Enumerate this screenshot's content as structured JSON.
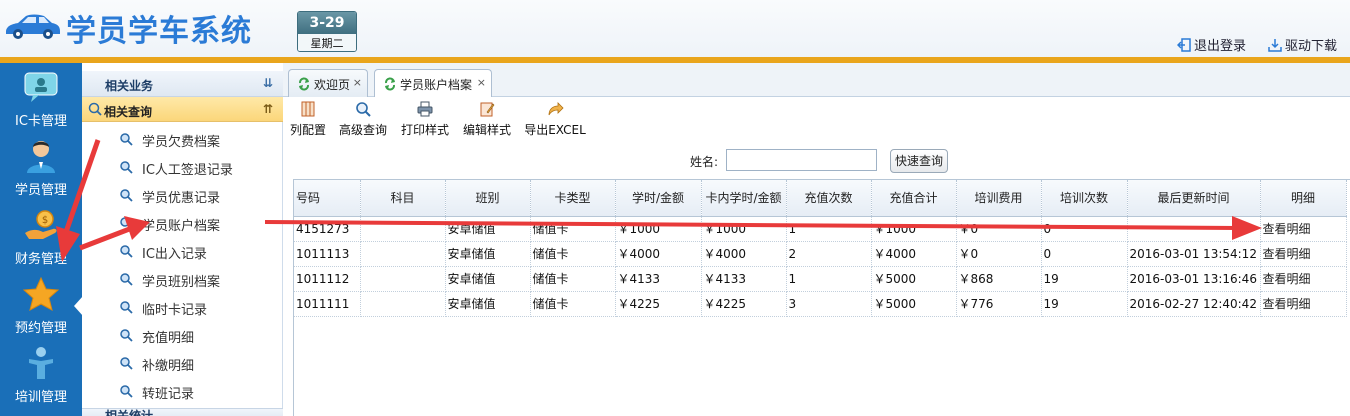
{
  "header": {
    "app_title": "学员学车系统",
    "date": "3-29",
    "weekday": "星期二",
    "logout_label": "退出登录",
    "driver_download_label": "驱动下载",
    "title_color": "#2b7bd6",
    "accent_color": "#e9a51c"
  },
  "iconbar": {
    "items": [
      {
        "label": "IC卡管理",
        "icon": "ic-card-icon"
      },
      {
        "label": "学员管理",
        "icon": "student-icon"
      },
      {
        "label": "财务管理",
        "icon": "finance-icon"
      },
      {
        "label": "预约管理",
        "icon": "star-icon"
      },
      {
        "label": "培训管理",
        "icon": "training-icon"
      }
    ]
  },
  "menu": {
    "header": "相关业务",
    "section": "相关查询",
    "items": [
      {
        "label": "学员欠费档案"
      },
      {
        "label": "IC人工签退记录"
      },
      {
        "label": "学员优惠记录"
      },
      {
        "label": "学员账户档案"
      },
      {
        "label": "IC出入记录"
      },
      {
        "label": "学员班别档案"
      },
      {
        "label": "临时卡记录"
      },
      {
        "label": "充值明细"
      },
      {
        "label": "补缴明细"
      },
      {
        "label": "转班记录"
      }
    ],
    "footer": "相关统计"
  },
  "tabs": [
    {
      "label": "欢迎页",
      "active": false
    },
    {
      "label": "学员账户档案",
      "active": true
    }
  ],
  "toolbar": {
    "buttons": [
      {
        "label": "列配置",
        "icon": "column-config-icon"
      },
      {
        "label": "高级查询",
        "icon": "advanced-search-icon"
      },
      {
        "label": "打印样式",
        "icon": "print-icon"
      },
      {
        "label": "编辑样式",
        "icon": "edit-style-icon"
      },
      {
        "label": "导出EXCEL",
        "icon": "export-icon"
      }
    ]
  },
  "search": {
    "name_label": "姓名:",
    "name_value": "",
    "quick_search_label": "快速查询"
  },
  "grid": {
    "columns": [
      "号码",
      "科目",
      "班别",
      "卡类型",
      "学时/金额",
      "卡内学时/金额",
      "充值次数",
      "充值合计",
      "培训费用",
      "培训次数",
      "最后更新时间",
      "明细"
    ],
    "rows": [
      [
        "4151273",
        "",
        "安卓储值",
        "储值卡",
        "￥1000",
        "￥1000",
        "1",
        "￥1000",
        "￥0",
        "0",
        "",
        "查看明细"
      ],
      [
        "1011113",
        "",
        "安卓储值",
        "储值卡",
        "￥4000",
        "￥4000",
        "2",
        "￥4000",
        "￥0",
        "0",
        "2016-03-01 13:54:12",
        "查看明细"
      ],
      [
        "1011112",
        "",
        "安卓储值",
        "储值卡",
        "￥4133",
        "￥4133",
        "1",
        "￥5000",
        "￥868",
        "19",
        "2016-03-01 13:16:46",
        "查看明细"
      ],
      [
        "1011111",
        "",
        "安卓储值",
        "储值卡",
        "￥4225",
        "￥4225",
        "3",
        "￥5000",
        "￥776",
        "19",
        "2016-02-27 12:40:42",
        "查看明细"
      ]
    ]
  },
  "annotation_color": "#e83a3a"
}
